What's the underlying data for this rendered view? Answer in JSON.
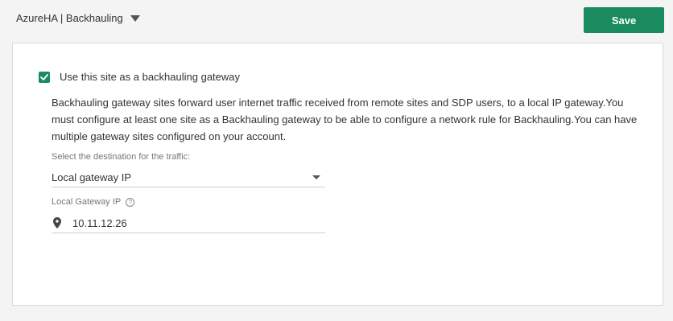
{
  "header": {
    "site_title": "AzureHA | Backhauling",
    "save_label": "Save"
  },
  "panel": {
    "checkbox_label": "Use this site as a backhauling gateway",
    "checkbox_checked": true,
    "description": "Backhauling gateway sites forward user internet traffic received from remote sites and SDP users, to a local IP gateway.You must configure at least one site as a Backhauling gateway to be able to configure a network rule for Backhauling.You can have multiple gateway sites configured on your account.",
    "destination": {
      "label": "Select the destination for the traffic:",
      "selected": "Local gateway IP"
    },
    "gateway": {
      "label": "Local Gateway IP",
      "help_icon": "?",
      "value": "10.11.12.26"
    }
  },
  "colors": {
    "accent": "#1a8a5f",
    "background": "#f4f4f4",
    "panel": "#ffffff"
  },
  "icons": {
    "site_dropdown": "caret-down-icon",
    "checkbox": "checkmark-icon",
    "destination_dropdown": "caret-down-icon",
    "help": "question-circle-icon",
    "gateway": "map-pin-icon"
  }
}
